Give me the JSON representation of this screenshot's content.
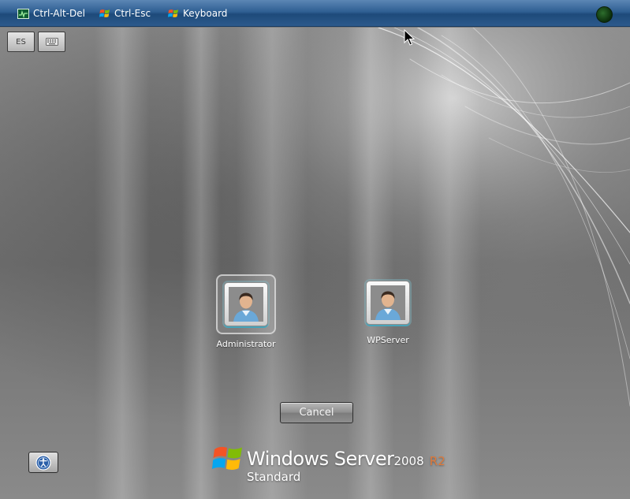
{
  "toolbar": {
    "items": [
      {
        "label": "Ctrl-Alt-Del",
        "icon": "monitor-activity-icon"
      },
      {
        "label": "Ctrl-Esc",
        "icon": "windows-flag-icon"
      },
      {
        "label": "Keyboard",
        "icon": "windows-flag-icon"
      }
    ],
    "status_icon": "connection-status-icon",
    "colors": {
      "bar_top": "#5b86b4",
      "bar_bottom": "#1e4a7a",
      "status": "#1a4a1a"
    }
  },
  "input_buttons": {
    "language_label": "ES",
    "osk_icon": "keyboard-icon"
  },
  "users": [
    {
      "name": "Administrator",
      "selected": true,
      "icon": "user-avatar-icon"
    },
    {
      "name": "WPServer",
      "selected": false,
      "icon": "user-avatar-icon"
    }
  ],
  "cancel_label": "Cancel",
  "ease_of_access_icon": "ease-of-access-icon",
  "branding": {
    "product": "Windows Server",
    "version": "2008",
    "release": "R2",
    "edition": "Standard",
    "logo_icon": "windows-logo-icon",
    "release_color": "#e07a3a"
  }
}
